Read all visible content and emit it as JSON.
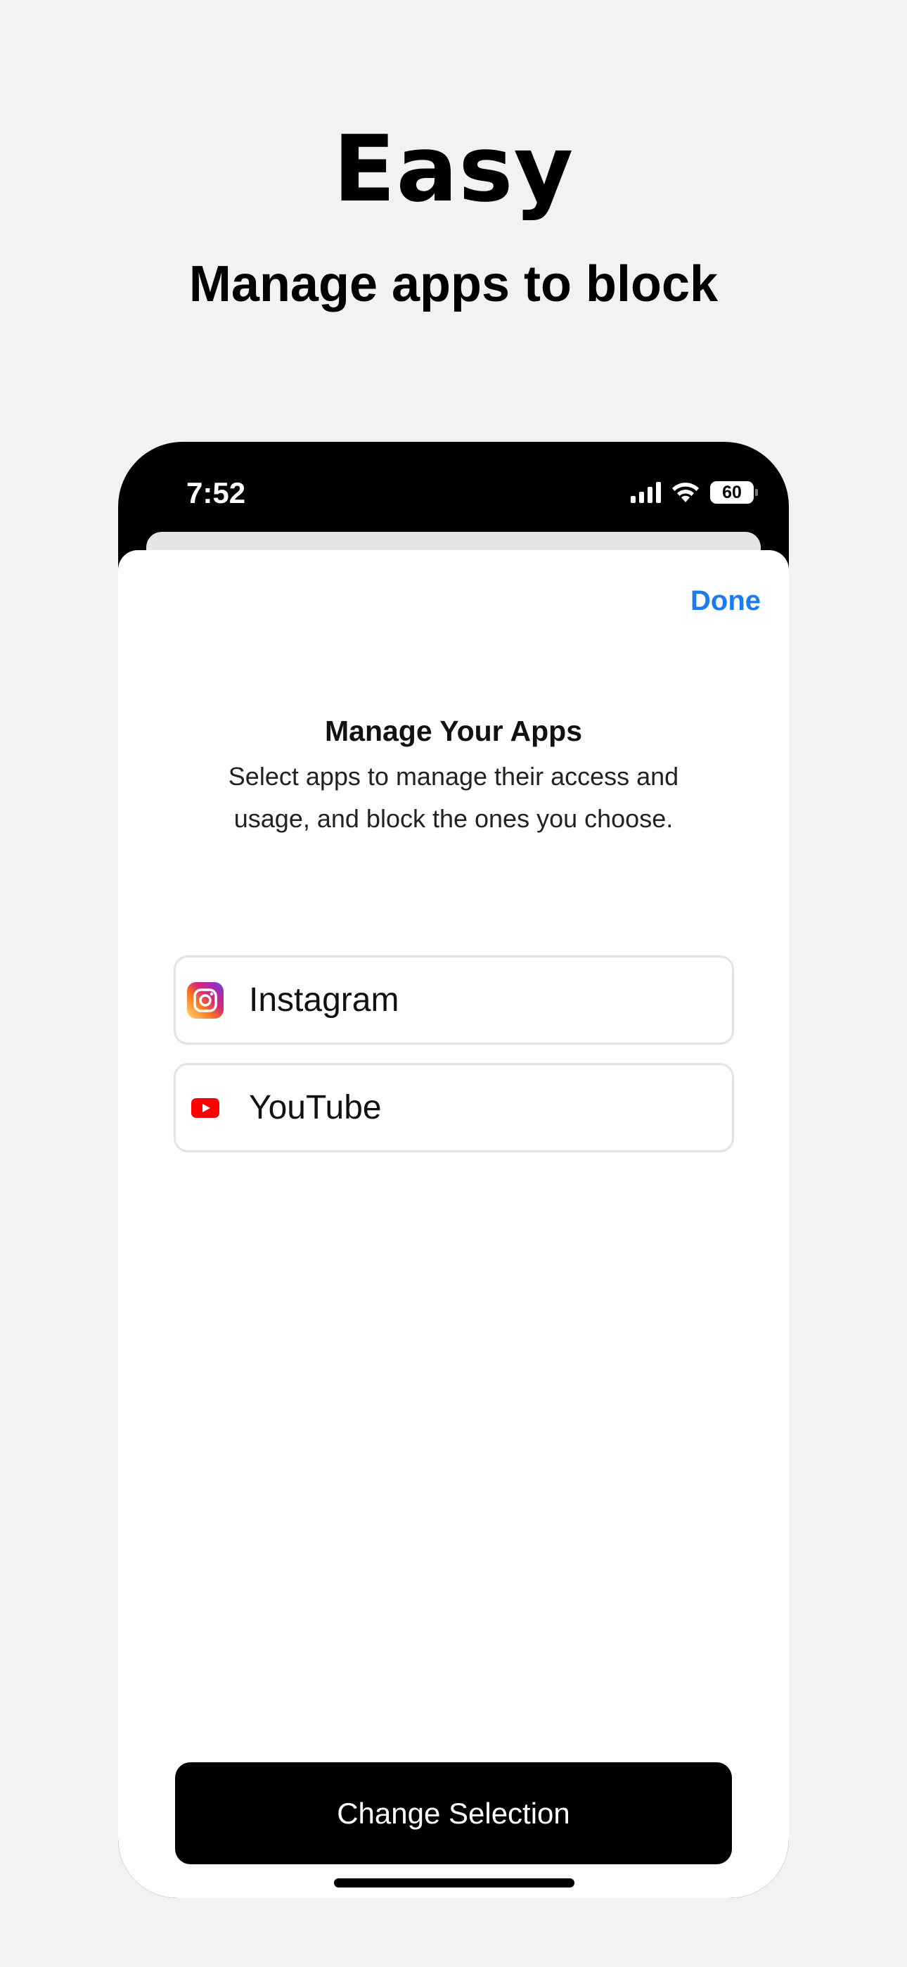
{
  "hero": {
    "title": "Easy",
    "subtitle": "Manage apps to block"
  },
  "status_bar": {
    "time": "7:52",
    "battery": "60",
    "icons": [
      "signal-icon",
      "wifi-icon",
      "battery-icon"
    ]
  },
  "sheet": {
    "done_label": "Done",
    "title": "Manage Your Apps",
    "description": "Select apps to manage their access and usage, and block the ones you choose.",
    "apps": [
      {
        "name": "Instagram",
        "icon": "instagram-icon"
      },
      {
        "name": "YouTube",
        "icon": "youtube-icon"
      }
    ],
    "change_label": "Change Selection"
  },
  "colors": {
    "accent": "#1a7cf0",
    "background": "#f2f2f2",
    "button": "#000000",
    "youtube": "#ff0000"
  }
}
